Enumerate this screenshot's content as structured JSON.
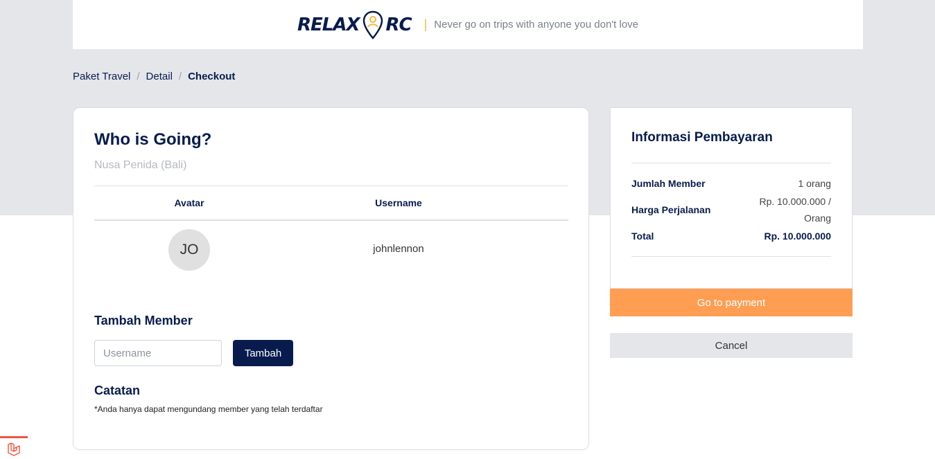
{
  "header": {
    "logo_left": "RELAX",
    "logo_right": "RC",
    "separator": "|",
    "tagline": "Never go on trips with anyone you don't love"
  },
  "breadcrumb": [
    {
      "label": "Paket Travel"
    },
    {
      "label": "Detail"
    },
    {
      "label": "Checkout"
    }
  ],
  "breadcrumb_separator": "/",
  "members": {
    "title": "Who is Going?",
    "subtitle": "Nusa Penida (Bali)",
    "columns": [
      "Avatar",
      "Username"
    ],
    "rows": [
      {
        "initials": "JO",
        "username": "johnlennon"
      }
    ]
  },
  "add_member": {
    "title": "Tambah Member",
    "placeholder": "Username",
    "value": "",
    "button_label": "Tambah"
  },
  "note": {
    "title": "Catatan",
    "text": "*Anda hanya dapat mengundang member yang telah terdaftar"
  },
  "payment": {
    "title": "Informasi Pembayaran",
    "rows": [
      {
        "label": "Jumlah Member",
        "value_lines": [
          "1 orang"
        ]
      },
      {
        "label": "Harga Perjalanan",
        "value_lines": [
          "Rp. 10.000.000 /",
          "Orang"
        ]
      },
      {
        "label": "Total",
        "value_lines": [
          "Rp. 10.000.000"
        ]
      }
    ],
    "pay_button": "Go to payment",
    "cancel_button": "Cancel"
  },
  "colors": {
    "navy": "#071C4D",
    "orange": "#FF9E53",
    "band_gray": "#E5E6EA",
    "accent_yellow": "#F4B940"
  }
}
